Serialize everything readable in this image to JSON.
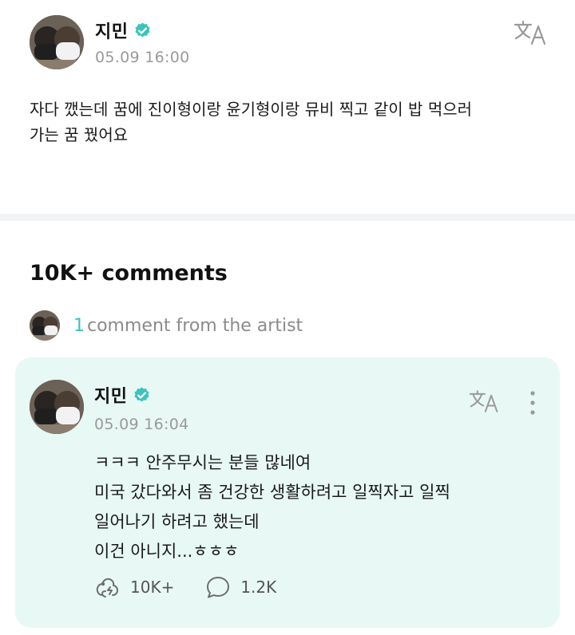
{
  "post": {
    "author": "지민",
    "timestamp": "05.09 16:00",
    "body_lines": [
      "자다 깼는데 꿈에 진이형이랑 윤기형이랑 뮤비 찍고 같이 밥 먹으러",
      "가는 꿈 꿨어요"
    ]
  },
  "comments": {
    "title": "10K+ comments",
    "artist_comment_count": "1",
    "artist_comment_label": "comment from the artist"
  },
  "artist_comment": {
    "author": "지민",
    "timestamp": "05.09 16:04",
    "body_lines": [
      "ㅋㅋㅋ 안주무시는 분들 많네여",
      "미국 갔다와서 좀 건강한 생활하려고 일찍자고 일찍",
      "일어나기 하려고 했는데",
      "이건 아니지...ㅎㅎㅎ"
    ],
    "like_count": "10K+",
    "reply_count": "1.2K"
  },
  "icons": {
    "verified": "verified-badge-icon",
    "translate": "translate-icon",
    "more": "more-vertical-icon",
    "like": "like-reaction-icon",
    "reply": "comment-bubble-icon"
  },
  "colors": {
    "accent": "#3bc3bd",
    "card_background": "#e8f8f5",
    "muted_text": "#9a9a9a"
  }
}
